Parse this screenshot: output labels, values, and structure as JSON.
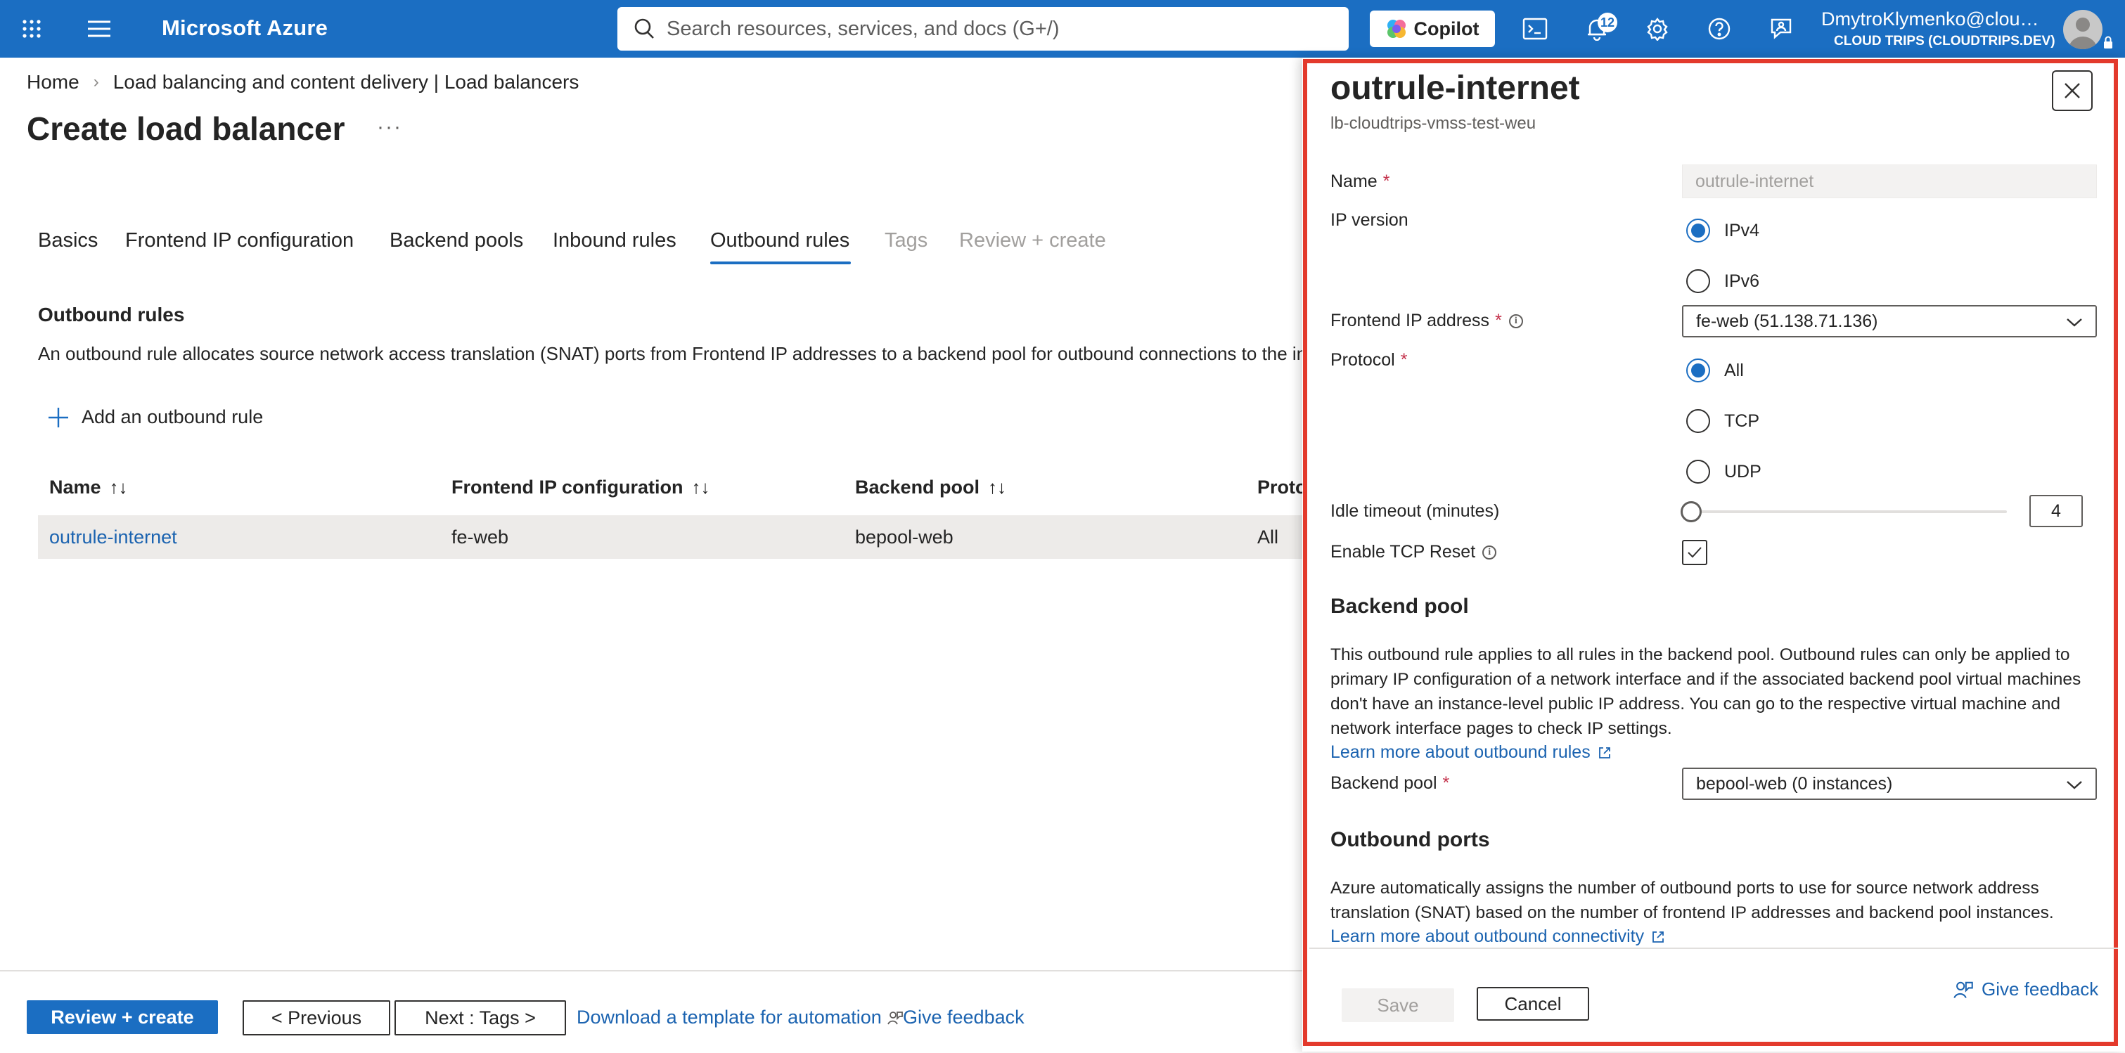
{
  "topbar": {
    "brand": "Microsoft Azure",
    "search_placeholder": "Search resources, services, and docs (G+/)",
    "copilot_label": "Copilot",
    "notification_count": "12",
    "account_name": "DmytroKlymenko@cloudtrips.dev",
    "account_org": "CLOUD TRIPS (CLOUDTRIPS.DEV)",
    "accent": "#1b6ec2"
  },
  "breadcrumb": {
    "home": "Home",
    "section": "Load balancing and content delivery | Load balancers"
  },
  "page": {
    "title": "Create load balancer",
    "more": "···"
  },
  "tabs": [
    {
      "label": "Basics",
      "state": "normal"
    },
    {
      "label": "Frontend IP configuration",
      "state": "normal"
    },
    {
      "label": "Backend pools",
      "state": "normal"
    },
    {
      "label": "Inbound rules",
      "state": "normal"
    },
    {
      "label": "Outbound rules",
      "state": "active"
    },
    {
      "label": "Tags",
      "state": "disabled"
    },
    {
      "label": "Review + create",
      "state": "disabled"
    }
  ],
  "outbound": {
    "title": "Outbound rules",
    "description": "An outbound rule allocates source network access translation (SNAT) ports from Frontend IP addresses to a backend pool for outbound connections to the in",
    "add_label": "Add an outbound rule",
    "columns": [
      "Name",
      "Frontend IP configuration",
      "Backend pool",
      "Proto"
    ],
    "rows": [
      {
        "name": "outrule-internet",
        "frontend": "fe-web",
        "backend": "bepool-web",
        "protocol": "All"
      }
    ]
  },
  "footer": {
    "review_create": "Review + create",
    "previous": "< Previous",
    "next": "Next : Tags >",
    "download_template": "Download a template for automation",
    "give_feedback": "Give feedback"
  },
  "panel": {
    "title": "outrule-internet",
    "subtitle": "lb-cloudtrips-vmss-test-weu",
    "name_label": "Name",
    "name_value": "outrule-internet",
    "ip_version_label": "IP version",
    "ip_versions": [
      {
        "label": "IPv4",
        "checked": true
      },
      {
        "label": "IPv6",
        "checked": false
      }
    ],
    "frontend_label": "Frontend IP address",
    "frontend_value": "fe-web (51.138.71.136)",
    "protocol_label": "Protocol",
    "protocols": [
      {
        "label": "All",
        "checked": true
      },
      {
        "label": "TCP",
        "checked": false
      },
      {
        "label": "UDP",
        "checked": false
      }
    ],
    "idle_label": "Idle timeout (minutes)",
    "idle_value": "4",
    "tcp_reset_label": "Enable TCP Reset",
    "tcp_reset_checked": true,
    "backend_heading": "Backend pool",
    "backend_text": "This outbound rule applies to all rules in the backend pool. Outbound rules can only be applied to primary IP configuration of a network interface and if the associated backend pool virtual machines don't have an instance-level public IP address. You can go to the respective virtual machine and network interface pages to check IP settings.",
    "backend_link": "Learn more about outbound rules",
    "backend_pool_label": "Backend pool",
    "backend_pool_value": "bepool-web (0 instances)",
    "ports_heading": "Outbound ports",
    "ports_text": "Azure automatically assigns the number of outbound ports to use for source network address translation (SNAT) based on the number of frontend IP addresses and backend pool instances.",
    "ports_link": "Learn more about outbound connectivity",
    "save": "Save",
    "cancel": "Cancel",
    "feedback": "Give feedback",
    "highlight_color": "#e33a2c"
  }
}
